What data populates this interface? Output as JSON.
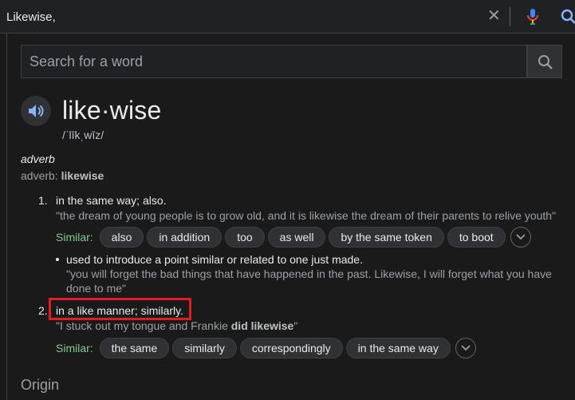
{
  "search": {
    "query": "Likewise,"
  },
  "icons": {
    "clear": "close-icon",
    "mic": "mic-icon",
    "lens": "search-icon"
  },
  "dictionary": {
    "search_placeholder": "Search for a word",
    "headword": "like·wise",
    "phonetic": "/ˈlīkˌwīz/",
    "pos": "adverb",
    "pos_label": "adverb",
    "pos_word": "likewise",
    "sense1": {
      "number": "1.",
      "definition": "in the same way; also.",
      "example": "\"the dream of young people is to grow old, and it is likewise the dream of their parents to relive youth\"",
      "similar_label": "Similar:",
      "similar": [
        "also",
        "in addition",
        "too",
        "as well",
        "by the same token",
        "to boot"
      ],
      "sub": {
        "definition": "used to introduce a point similar or related to one just made.",
        "example": "\"you will forget the bad things that have happened in the past. Likewise, I will forget what you have done to me\""
      }
    },
    "sense2": {
      "number": "2.",
      "definition": "in a like manner; similarly.",
      "example_pre": "\"I stuck out my tongue and Frankie ",
      "example_bold": "did likewise",
      "example_post": "\"",
      "similar_label": "Similar:",
      "similar": [
        "the same",
        "similarly",
        "correspondingly",
        "in the same way"
      ]
    },
    "origin_label": "Origin"
  },
  "colors": {
    "highlight": "#e31b23",
    "accent_green": "#81c995",
    "background": "#1a1a1a"
  }
}
